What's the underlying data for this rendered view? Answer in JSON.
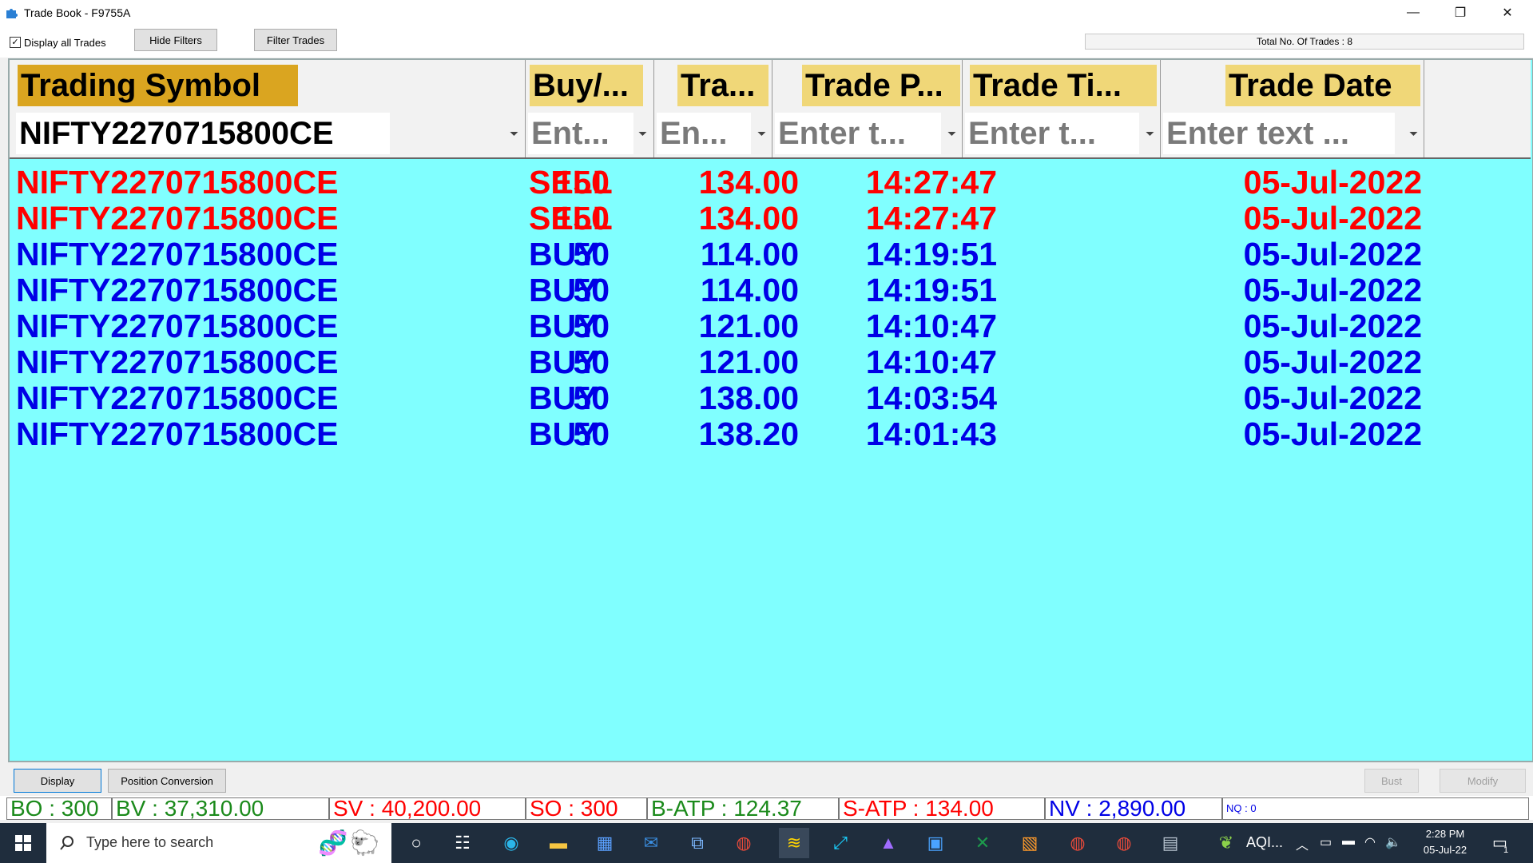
{
  "window": {
    "title": "Trade Book - F9755A",
    "minimize": "—",
    "restore": "❐",
    "close": "✕"
  },
  "toolbar": {
    "display_all_label": "Display all Trades",
    "display_all_checked": "✓",
    "hide_filters_label": "Hide Filters",
    "filter_trades_label": "Filter Trades",
    "total_trades": "Total No. Of Trades : 8"
  },
  "table": {
    "columns": [
      "Trading Symbol",
      "Buy/...",
      "Tra...",
      "Trade P...",
      "Trade Ti...",
      "Trade Date"
    ],
    "filters": [
      "NIFTY2270715800CE",
      "Ent...",
      "En...",
      "Enter t...",
      "Enter t...",
      "Enter text ..."
    ],
    "rows": [
      {
        "symbol": "NIFTY2270715800CE",
        "side": "SELL",
        "qty": "150",
        "price": "134.00",
        "time": "14:27:47",
        "date": "05-Jul-2022"
      },
      {
        "symbol": "NIFTY2270715800CE",
        "side": "SELL",
        "qty": "150",
        "price": "134.00",
        "time": "14:27:47",
        "date": "05-Jul-2022"
      },
      {
        "symbol": "NIFTY2270715800CE",
        "side": "BUY",
        "qty": "50",
        "price": "114.00",
        "time": "14:19:51",
        "date": "05-Jul-2022"
      },
      {
        "symbol": "NIFTY2270715800CE",
        "side": "BUY",
        "qty": "50",
        "price": "114.00",
        "time": "14:19:51",
        "date": "05-Jul-2022"
      },
      {
        "symbol": "NIFTY2270715800CE",
        "side": "BUY",
        "qty": "50",
        "price": "121.00",
        "time": "14:10:47",
        "date": "05-Jul-2022"
      },
      {
        "symbol": "NIFTY2270715800CE",
        "side": "BUY",
        "qty": "50",
        "price": "121.00",
        "time": "14:10:47",
        "date": "05-Jul-2022"
      },
      {
        "symbol": "NIFTY2270715800CE",
        "side": "BUY",
        "qty": "50",
        "price": "138.00",
        "time": "14:03:54",
        "date": "05-Jul-2022"
      },
      {
        "symbol": "NIFTY2270715800CE",
        "side": "BUY",
        "qty": "50",
        "price": "138.20",
        "time": "14:01:43",
        "date": "05-Jul-2022"
      }
    ]
  },
  "buttons": {
    "display": "Display",
    "position_conversion": "Position Conversion",
    "bust": "Bust",
    "modify": "Modify"
  },
  "status": {
    "bo": "BO : 300",
    "bv": "BV : 37,310.00",
    "sv": "SV : 40,200.00",
    "so": "SO : 300",
    "batp": "B-ATP : 124.37",
    "satp": "S-ATP : 134.00",
    "nv": "NV : 2,890.00",
    "nq": "NQ : 0"
  },
  "taskbar": {
    "search_placeholder": "Type here to search",
    "aqi": "AQI...",
    "time": "2:28 PM",
    "date": "05-Jul-22",
    "notification_count": "1"
  },
  "colors": {
    "grid_bg": "#80ffff",
    "sell": "#ff0000",
    "buy": "#0000e6",
    "header_label": "#f0d778",
    "symbol_header": "#daa520"
  }
}
